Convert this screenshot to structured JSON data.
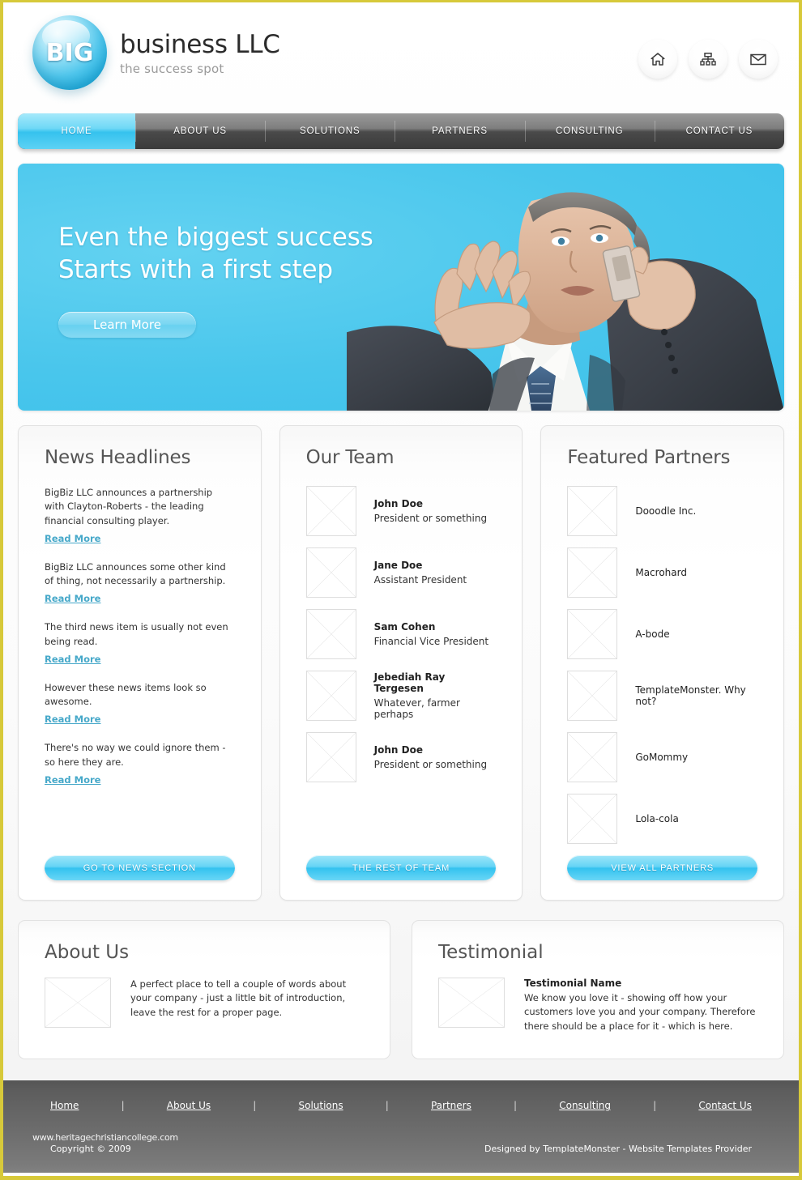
{
  "brand": {
    "logo_badge": "BIG",
    "title": "business LLC",
    "tagline": "the success spot"
  },
  "header": {
    "icons": [
      {
        "name": "home-icon",
        "label": "Home"
      },
      {
        "name": "sitemap-icon",
        "label": "Sitemap"
      },
      {
        "name": "mail-icon",
        "label": "Contact"
      }
    ]
  },
  "nav": {
    "items": [
      {
        "label": "HOME",
        "active": true
      },
      {
        "label": "ABOUT US",
        "active": false
      },
      {
        "label": "SOLUTIONS",
        "active": false
      },
      {
        "label": "PARTNERS",
        "active": false
      },
      {
        "label": "CONSULTING",
        "active": false
      },
      {
        "label": "CONTACT US",
        "active": false
      }
    ]
  },
  "hero": {
    "line1": "Even the biggest success",
    "line2": "Starts with a first step",
    "button": "Learn More",
    "image_alt": "businessman-on-phone-photo",
    "bg_color": "#4cc8ed"
  },
  "news": {
    "title": "News Headlines",
    "items": [
      {
        "text": "BigBiz LLC announces a partnership with Clayton-Roberts - the leading financial consulting player.",
        "link": "Read More"
      },
      {
        "text": "BigBiz LLC announces some other kind of thing, not necessarily a partnership.",
        "link": "Read More"
      },
      {
        "text": "The third news item is usually not even being read.",
        "link": "Read More"
      },
      {
        "text": "However these news items look so awesome.",
        "link": "Read More"
      },
      {
        "text": "There's no way  we could ignore them - so here they are.",
        "link": "Read More"
      }
    ],
    "cta": "GO TO NEWS SECTION"
  },
  "team": {
    "title": "Our Team",
    "members": [
      {
        "name": "John Doe",
        "role": "President or something"
      },
      {
        "name": "Jane Doe",
        "role": "Assistant President"
      },
      {
        "name": "Sam Cohen",
        "role": "Financial Vice President"
      },
      {
        "name": "Jebediah Ray Tergesen",
        "role": "Whatever, farmer perhaps"
      },
      {
        "name": "John Doe",
        "role": "President or something"
      }
    ],
    "cta": "THE REST OF TEAM"
  },
  "partners": {
    "title": "Featured Partners",
    "items": [
      {
        "name": "Dooodle Inc."
      },
      {
        "name": "Macrohard"
      },
      {
        "name": "A-bode"
      },
      {
        "name": "TemplateMonster. Why not?"
      },
      {
        "name": "GoMommy"
      },
      {
        "name": "Lola-cola"
      }
    ],
    "cta": "VIEW ALL PARTNERS"
  },
  "about": {
    "title": "About Us",
    "text": "A perfect place to tell a couple of words about your company - just a little bit of introduction, leave the rest for a proper page."
  },
  "testimonial": {
    "title": "Testimonial",
    "name": "Testimonial Name",
    "text": "We know you love it - showing off how your customers love you and your company. Therefore there should be a place for it - which is here."
  },
  "footer": {
    "links": [
      "Home",
      "About Us",
      "Solutions",
      "Partners",
      "Consulting",
      "Contact Us"
    ],
    "separator": "|",
    "copyright": "Copyright © 2009",
    "credit": "Designed by TemplateMonster - Website Templates Provider",
    "watermark": "www.heritagechristiancollege.com"
  },
  "colors": {
    "accent": "#35c2ef",
    "page_border": "#d7c93a",
    "nav_dark": "#5a5a5a",
    "link": "#46a8c9"
  }
}
